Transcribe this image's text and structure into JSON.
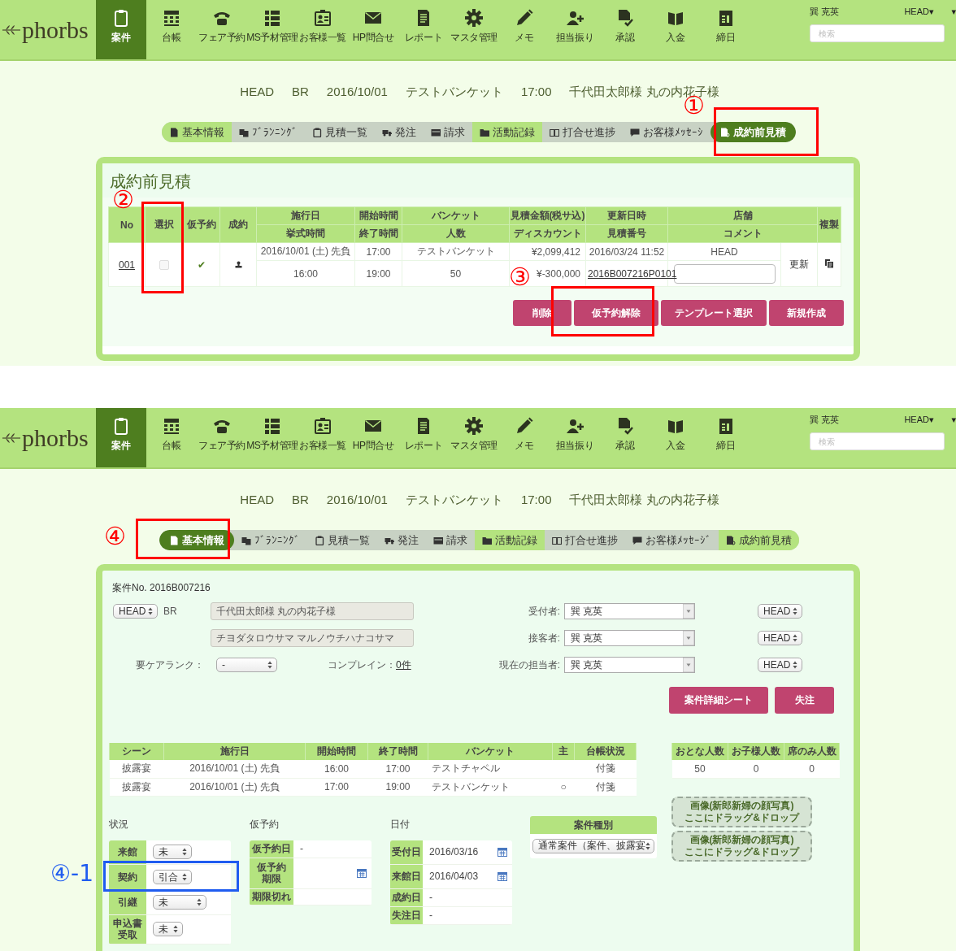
{
  "screens": [
    {
      "kind": "estimate",
      "header": {
        "logo": "phorbs",
        "nav": [
          {
            "label": "案件",
            "selected": true
          },
          {
            "label": "台帳",
            "selected": false
          },
          {
            "label": "フェア予約",
            "selected": false
          },
          {
            "label": "MS予材管理",
            "selected": false
          },
          {
            "label": "お客様一覧",
            "selected": false
          },
          {
            "label": "HP問合せ",
            "selected": false
          },
          {
            "label": "レポート",
            "selected": false
          },
          {
            "label": "マスタ管理",
            "selected": false
          },
          {
            "label": "メモ",
            "selected": false
          },
          {
            "label": "担当振り",
            "selected": false
          },
          {
            "label": "承認",
            "selected": false
          },
          {
            "label": "入金",
            "selected": false
          },
          {
            "label": "締日",
            "selected": false
          }
        ],
        "user": "巽 克英",
        "store": "HEAD▾",
        "caret": "▾",
        "search": {
          "placeholder": "検索"
        }
      },
      "summary": [
        "HEAD",
        "BR",
        "2016/10/01",
        "テストバンケット",
        "17:00",
        "千代田太郎様 丸の内花子様"
      ],
      "tabs": [
        {
          "label": "基本情報",
          "selected": false,
          "filled": true
        },
        {
          "label": "ﾌﾞﾗﾝﾆﾝｸﾞ",
          "selected": false,
          "filled": false
        },
        {
          "label": "見積一覧",
          "selected": false,
          "filled": false
        },
        {
          "label": "発注",
          "selected": false,
          "filled": false
        },
        {
          "label": "請求",
          "selected": false,
          "filled": false
        },
        {
          "label": "活動記録",
          "selected": false,
          "filled": true
        },
        {
          "label": "打合せ進捗",
          "selected": false,
          "filled": false
        },
        {
          "label": "お客様ﾒｯｾｰｼ",
          "selected": false,
          "filled": false
        },
        {
          "label": "成約前見積",
          "selected": true,
          "filled": false
        }
      ],
      "estimate": {
        "title": "成約前見積",
        "columns": [
          {
            "top": "No"
          },
          {
            "top": "選択"
          },
          {
            "top": "仮予約"
          },
          {
            "top": "成約"
          },
          {
            "top": "施行日",
            "bottom": "挙式時間"
          },
          {
            "top": "開始時間",
            "bottom": "終了時間"
          },
          {
            "top": "バンケット",
            "bottom": "人数"
          },
          {
            "top": "見積金額(税サ込)",
            "bottom": "ディスカウント"
          },
          {
            "top": "更新日時",
            "bottom": "見積番号"
          },
          {
            "top": "店舗",
            "bottom": "コメント"
          },
          {
            "top": "複製"
          }
        ],
        "rows": [
          {
            "no": "001",
            "checked": false,
            "provisional": "✔",
            "pairs": [
              [
                "2016/10/01 (土) 先負",
                "16:00"
              ],
              [
                "17:00",
                "19:00"
              ],
              [
                "テストバンケット",
                "50"
              ],
              [
                "¥2,099,412",
                "¥-300,000"
              ],
              [
                "2016/03/24 11:52",
                "2016B007216P0101"
              ]
            ],
            "store": "HEAD",
            "update": "更新"
          }
        ],
        "buttons": [
          "削除",
          "仮予約解除",
          "テンプレート選択",
          "新規作成"
        ]
      }
    },
    {
      "kind": "basic",
      "header": {
        "logo": "phorbs",
        "nav": [
          {
            "label": "案件",
            "selected": true
          },
          {
            "label": "台帳",
            "selected": false
          },
          {
            "label": "フェア予約",
            "selected": false
          },
          {
            "label": "MS予材管理",
            "selected": false
          },
          {
            "label": "お客様一覧",
            "selected": false
          },
          {
            "label": "HP問合せ",
            "selected": false
          },
          {
            "label": "レポート",
            "selected": false
          },
          {
            "label": "マスタ管理",
            "selected": false
          },
          {
            "label": "メモ",
            "selected": false
          },
          {
            "label": "担当振り",
            "selected": false
          },
          {
            "label": "承認",
            "selected": false
          },
          {
            "label": "入金",
            "selected": false
          },
          {
            "label": "締日",
            "selected": false
          }
        ],
        "user": "巽 克英",
        "store": "HEAD▾",
        "caret": "▾",
        "search": {
          "placeholder": "検索"
        }
      },
      "summary": [
        "HEAD",
        "BR",
        "2016/10/01",
        "テストバンケット",
        "17:00",
        "千代田太郎様 丸の内花子様"
      ],
      "tabs": [
        {
          "label": "基本情報",
          "selected": true,
          "filled": false
        },
        {
          "label": "ﾌﾞﾗﾝﾆﾝｸﾞ",
          "selected": false,
          "filled": false
        },
        {
          "label": "見積一覧",
          "selected": false,
          "filled": false
        },
        {
          "label": "発注",
          "selected": false,
          "filled": false
        },
        {
          "label": "請求",
          "selected": false,
          "filled": false
        },
        {
          "label": "活動記録",
          "selected": false,
          "filled": true
        },
        {
          "label": "打合せ進捗",
          "selected": false,
          "filled": false
        },
        {
          "label": "お客様ﾒｯｾｰｼﾞ",
          "selected": false,
          "filled": false
        },
        {
          "label": "成約前見積",
          "selected": false,
          "filled": true
        }
      ],
      "basic": {
        "case_no": "案件No. 2016B007216",
        "store_select": "HEAD",
        "branch": "BR",
        "names": [
          "千代田太郎様 丸の内花子様",
          "チヨダタロウサマ マルノウチハナコサマ"
        ],
        "staff": [
          {
            "label": "受付者:",
            "value": "巽 克英",
            "store": "HEAD"
          },
          {
            "label": "接客者:",
            "value": "巽 克英",
            "store": "HEAD"
          },
          {
            "label": "現在の担当者:",
            "value": "巽 克英",
            "store": "HEAD"
          }
        ],
        "care_rank": {
          "label": "要ケアランク：",
          "value": "-"
        },
        "complaint": {
          "label": "コンプレイン：",
          "value": "0件"
        },
        "buttons": [
          "案件詳細シート",
          "失注"
        ],
        "scenes": {
          "columns": [
            "シーン",
            "施行日",
            "開始時間",
            "終了時間",
            "バンケット",
            "主",
            "台帳状況"
          ],
          "rows": [
            [
              "披露宴",
              "2016/10/01 (土) 先負",
              "16:00",
              "17:00",
              "テストチャペル",
              null,
              "付箋"
            ],
            [
              "披露宴",
              "2016/10/01 (土) 先負",
              "17:00",
              "19:00",
              "テストバンケット",
              "○",
              "付箋"
            ]
          ]
        },
        "counts": {
          "columns": [
            "おとな人数",
            "お子様人数",
            "席のみ人数"
          ],
          "rows": [
            [
              "50",
              "0",
              "0"
            ]
          ]
        },
        "status": {
          "title": "状況",
          "rows": [
            {
              "label": [
                "来館"
              ],
              "value": "未"
            },
            {
              "label": [
                "契約"
              ],
              "value": "引合"
            },
            {
              "label": [
                "引継"
              ],
              "value": "未"
            },
            {
              "label": [
                "申込書",
                "受取"
              ],
              "value": "未"
            }
          ]
        },
        "provisional": {
          "title": "仮予約",
          "rows": [
            {
              "label": [
                "仮予約日"
              ],
              "value": "-",
              "kind": "text"
            },
            {
              "label": [
                "仮予約",
                "期限"
              ],
              "kind": "date"
            },
            {
              "label": [
                "期限切れ"
              ],
              "kind": "text"
            }
          ]
        },
        "dates": {
          "title": "日付",
          "rows": [
            {
              "label": [
                "受付日"
              ],
              "value": "2016/03/16",
              "kind": "date"
            },
            {
              "label": [
                "来館日"
              ],
              "value": "2016/04/03",
              "kind": "date"
            },
            {
              "label": [
                "成約日"
              ],
              "value": "-",
              "kind": "text"
            },
            {
              "label": [
                "失注日"
              ],
              "value": "-",
              "kind": "text"
            }
          ]
        },
        "case_type": {
          "title": "案件種別",
          "value": "通常案件（案件、披露宴"
        },
        "dropzones": [
          {
            "lines": [
              "画像(新郎新婦の顔写真)",
              "ここにドラッグ&ドロップ"
            ]
          },
          {
            "lines": [
              "画像(新郎新婦の顔写真)",
              "ここにドラッグ&ドロップ"
            ]
          }
        ]
      }
    }
  ],
  "annotations": [
    {
      "label": "①",
      "color": "#ff0000"
    },
    {
      "label": "②",
      "color": "#ff0000"
    },
    {
      "label": "③",
      "color": "#ff0000"
    },
    {
      "label": "④",
      "color": "#ff0000"
    },
    {
      "label": "④-1",
      "color": "#1f5cf0"
    }
  ]
}
